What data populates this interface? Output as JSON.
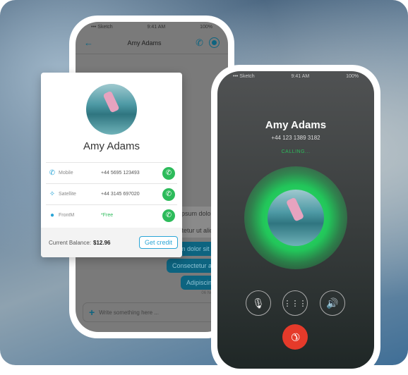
{
  "back_phone": {
    "status": {
      "carrier": "••• Sketch",
      "time": "9:41 AM",
      "battery": "100%"
    },
    "title": "Amy Adams",
    "icons": [
      "back-arrow-icon",
      "phone-icon",
      "record-icon"
    ],
    "incoming": [
      "Lorem ipsum dolor sit amet",
      "Consectetur ut aliqua"
    ],
    "outgoing": [
      "Lorem ipsum dolor sit amet",
      "Consectetur aliqua",
      "Adipiscing elit"
    ],
    "timestamp": "06 Nov · 11:2",
    "compose_placeholder": "Write something here ..."
  },
  "contact_card": {
    "name": "Amy Adams",
    "rows": [
      {
        "icon": "phone-icon",
        "label": "Mobile",
        "value": "+44 5695 123493"
      },
      {
        "icon": "satellite-icon",
        "label": "Satellite",
        "value": "+44 3145 697020"
      },
      {
        "icon": "frontm-icon",
        "label": "FrontM",
        "value": "*Free"
      }
    ],
    "balance_label": "Current Balance:",
    "balance_value": "$12.96",
    "credit_button": "Get credit",
    "accent": "#2aa5d6",
    "call_color": "#2dbb5b"
  },
  "front_phone": {
    "status": {
      "carrier": "••• Sketch",
      "time": "9:41 AM",
      "battery": "100%"
    },
    "name": "Amy Adams",
    "number": "+44 123 1389 3182",
    "state": "CALLING...",
    "controls": [
      "mute-icon",
      "keypad-icon",
      "speaker-icon"
    ],
    "hangup_color": "#e53a2a"
  }
}
